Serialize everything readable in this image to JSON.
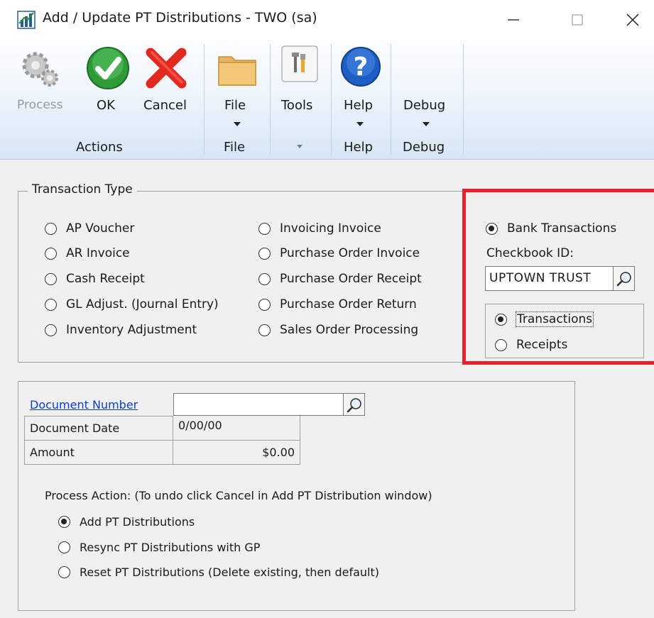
{
  "window": {
    "title": "Add / Update PT Distributions  -  TWO (sa)",
    "minimize_glyph": "—",
    "maximize_glyph": "☐",
    "close_glyph": "✕"
  },
  "ribbon": {
    "actions": {
      "process_label": "Process",
      "ok_label": "OK",
      "cancel_label": "Cancel",
      "group_label": "Actions"
    },
    "file": {
      "label": "File",
      "group_label": "File"
    },
    "tools": {
      "label": "Tools"
    },
    "help": {
      "label": "Help",
      "group_label": "Help"
    },
    "debug": {
      "label": "Debug",
      "group_label": "Debug"
    }
  },
  "transaction_type": {
    "legend": "Transaction Type",
    "options_left": [
      {
        "label": "AP Voucher",
        "selected": false
      },
      {
        "label": "AR Invoice",
        "selected": false
      },
      {
        "label": "Cash Receipt",
        "selected": false
      },
      {
        "label": "GL Adjust. (Journal Entry)",
        "selected": false
      },
      {
        "label": "Inventory Adjustment",
        "selected": false
      }
    ],
    "options_middle": [
      {
        "label": "Invoicing Invoice",
        "selected": false
      },
      {
        "label": "Purchase Order Invoice",
        "selected": false
      },
      {
        "label": "Purchase Order Receipt",
        "selected": false
      },
      {
        "label": "Purchase Order Return",
        "selected": false
      },
      {
        "label": "Sales Order Processing",
        "selected": false
      }
    ],
    "bank": {
      "label": "Bank Transactions",
      "selected": true,
      "checkbook_label": "Checkbook ID:",
      "checkbook_value": "UPTOWN TRUST",
      "sub_options": [
        {
          "label": "Transactions",
          "selected": true
        },
        {
          "label": "Receipts",
          "selected": false
        }
      ]
    },
    "highlight_color": "#e8202a"
  },
  "document": {
    "number_label": "Document Number",
    "number_value": "",
    "date_label": "Document Date",
    "date_value": "0/00/00",
    "amount_label": "Amount",
    "amount_value": "$0.00"
  },
  "process_action": {
    "label": "Process Action: (To undo click Cancel in Add PT Distribution window)",
    "options": [
      {
        "label": "Add PT Distributions",
        "selected": true
      },
      {
        "label": "Resync PT Distributions with GP",
        "selected": false
      },
      {
        "label": "Reset PT Distributions (Delete existing, then default)",
        "selected": false
      }
    ]
  }
}
